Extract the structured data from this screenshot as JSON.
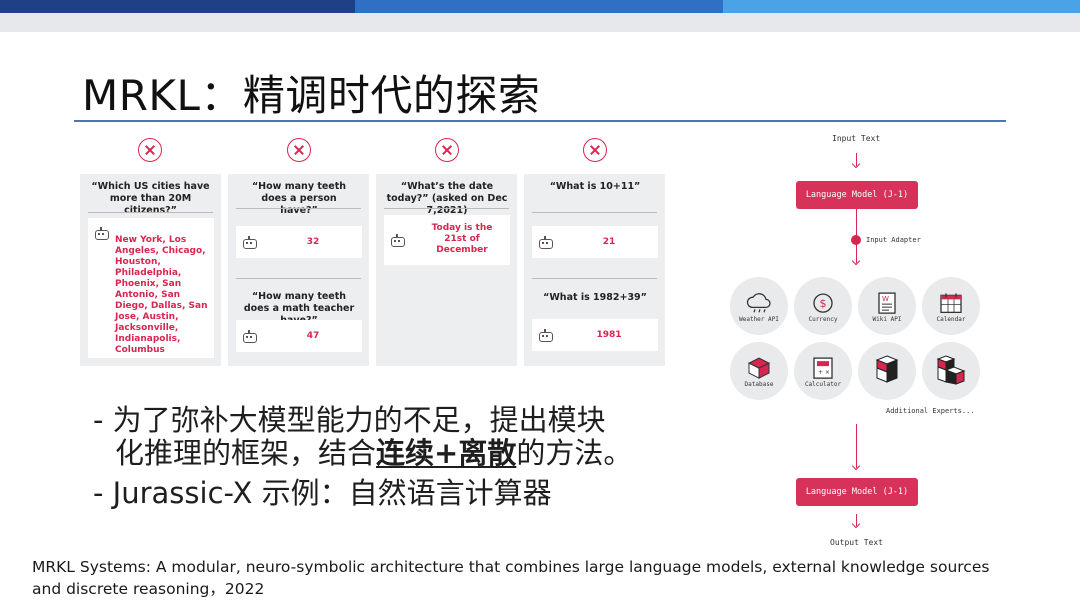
{
  "slide": {
    "title": "MRKL：精调时代的探索",
    "bullet1_line1": "- 为了弥补大模型能力的不足，提出模块",
    "bullet1_line2_pre": "化推理的框架，结合",
    "bullet1_line2_bold": "连续+离散",
    "bullet1_line2_post": "的方法。",
    "bullet2": "- Jurassic-X 示例：自然语言计算器",
    "citation": "MRKL Systems: A modular, neuro-symbolic architecture that combines large language models, external knowledge sources and discrete reasoning，2022"
  },
  "examples": {
    "q1": "“Which US cities have more than 20M citizens?”",
    "a1": "New York, Los Angeles, Chicago, Houston, Philadelphia, Phoenix, San Antonio, San Diego, Dallas, San Jose, Austin, Jacksonville, Indianapolis, Columbus",
    "q2": "“How many teeth does a person have?”",
    "a2": "32",
    "q3": "“How many teeth does a math teacher have?”",
    "a3": "47",
    "q4": "“What’s the date today?” (asked on Dec 7,2021)",
    "a4": "Today is the 21st of December",
    "q5": "“What is 10+11”",
    "a5": "21",
    "q6": "“What is 1982+39”",
    "a6": "1981"
  },
  "diagram": {
    "input_text": "Input Text",
    "lm_top": "Language Model (J-1)",
    "input_adapter": "Input Adapter",
    "experts": [
      "Weather API",
      "Currency",
      "Wiki API",
      "Calendar",
      "Database",
      "Calculator"
    ],
    "additional": "Additional Experts...",
    "lm_bottom": "Language Model (J-1)",
    "output_text": "Output Text"
  },
  "colors": {
    "accent": "#d7264f",
    "title_rule": "#4f73b9",
    "panel": "#eceeef"
  },
  "icons": [
    "x-circle-icon",
    "robot-icon",
    "cloud-icon",
    "coin-icon",
    "wiki-icon",
    "calendar-icon",
    "database-icon",
    "calculator-icon",
    "cube-icon",
    "blocks-icon"
  ]
}
